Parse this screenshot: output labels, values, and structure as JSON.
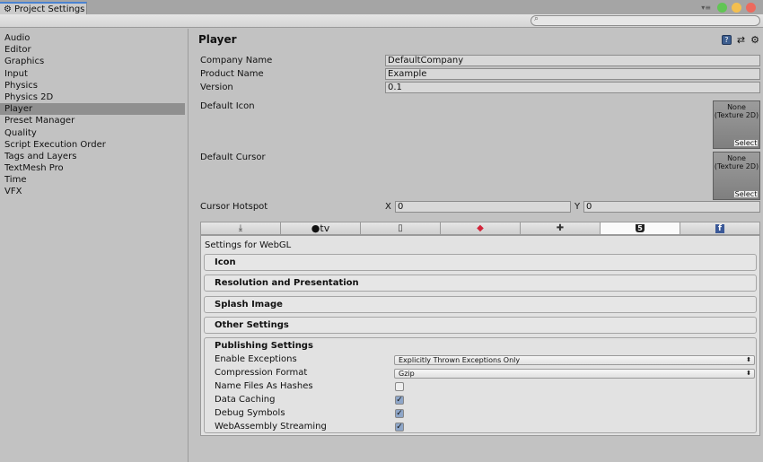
{
  "window": {
    "tab_title": "Project Settings",
    "search_placeholder": ""
  },
  "colors": {
    "close": "#ec6a5e",
    "minimize": "#f4bf4f",
    "maximize": "#61c554",
    "selection": "#8f8f8f",
    "active_tab_accent": "#4a83d1"
  },
  "sidebar": {
    "items": [
      {
        "label": "Audio"
      },
      {
        "label": "Editor"
      },
      {
        "label": "Graphics"
      },
      {
        "label": "Input"
      },
      {
        "label": "Physics"
      },
      {
        "label": "Physics 2D"
      },
      {
        "label": "Player",
        "selected": true
      },
      {
        "label": "Preset Manager"
      },
      {
        "label": "Quality"
      },
      {
        "label": "Script Execution Order"
      },
      {
        "label": "Tags and Layers"
      },
      {
        "label": "TextMesh Pro"
      },
      {
        "label": "Time"
      },
      {
        "label": "VFX"
      }
    ]
  },
  "player": {
    "title": "Player",
    "company_name_label": "Company Name",
    "company_name": "DefaultCompany",
    "product_name_label": "Product Name",
    "product_name": "Example",
    "version_label": "Version",
    "version": "0.1",
    "default_icon_label": "Default Icon",
    "default_icon_value": "None (Texture 2D)",
    "default_cursor_label": "Default Cursor",
    "default_cursor_value": "None (Texture 2D)",
    "select_label": "Select",
    "cursor_hotspot_label": "Cursor Hotspot",
    "hotspot_x_label": "X",
    "hotspot_x": "0",
    "hotspot_y_label": "Y",
    "hotspot_y": "0"
  },
  "platform_tabs": [
    {
      "name": "standalone",
      "icon": "download-icon",
      "glyph": "⤓"
    },
    {
      "name": "tvos",
      "icon": "apple-tv-icon",
      "glyph": "tv"
    },
    {
      "name": "ios",
      "icon": "phone-icon",
      "glyph": "▯"
    },
    {
      "name": "lumin",
      "icon": "lumin-icon",
      "glyph": "◆"
    },
    {
      "name": "android",
      "icon": "android-icon",
      "glyph": "✚"
    },
    {
      "name": "webgl",
      "icon": "html5-icon",
      "glyph": "5",
      "active": true
    },
    {
      "name": "facebook",
      "icon": "facebook-icon",
      "glyph": "f"
    }
  ],
  "settings": {
    "header": "Settings for WebGL",
    "sections": [
      "Icon",
      "Resolution and Presentation",
      "Splash Image",
      "Other Settings"
    ],
    "publishing": {
      "title": "Publishing Settings",
      "enable_exceptions_label": "Enable Exceptions",
      "enable_exceptions_value": "Explicitly Thrown Exceptions Only",
      "compression_format_label": "Compression Format",
      "compression_format_value": "Gzip",
      "name_files_as_hashes_label": "Name Files As Hashes",
      "name_files_as_hashes": false,
      "data_caching_label": "Data Caching",
      "data_caching": true,
      "debug_symbols_label": "Debug Symbols",
      "debug_symbols": true,
      "webassembly_streaming_label": "WebAssembly Streaming",
      "webassembly_streaming": true
    }
  }
}
